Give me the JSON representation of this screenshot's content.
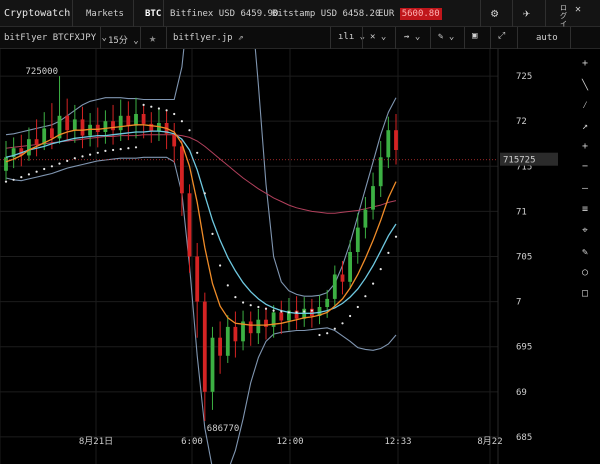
{
  "topbar": {
    "brand": "Cryptowatch",
    "markets": "Markets",
    "coin": "BTC",
    "ticker1_exchange": "Bitfinex",
    "ticker1_pair": "USD",
    "ticker1_price": "6459.90",
    "ticker2_exchange": "Bitstamp",
    "ticker2_pair": "USD",
    "ticker2_price": "6458.20",
    "ticker3_pair": "EUR",
    "ticker3_price": "5600.80",
    "login": "ログイン"
  },
  "toolbar": {
    "market": "bitFlyer BTCFXJPY",
    "interval": "15分",
    "url": "bitflyer.jp",
    "scale": "auto"
  },
  "colors": {
    "up": "#3cb043",
    "down": "#d42323",
    "ema_fast": "#f08c28",
    "ema_slow": "#6ec8e0",
    "sma_long": "#b2405c",
    "bollinger": "#7f95b0",
    "parabolic": "#e8e8e8",
    "last_price_bg": "#2b2b2b"
  },
  "chart_data": {
    "type": "candlestick",
    "y_ticks": [
      "725",
      "72",
      "715",
      "71",
      "705",
      "7",
      "695",
      "69",
      "685"
    ],
    "y_tick_values": [
      725,
      720,
      715,
      710,
      705,
      700,
      695,
      690,
      685
    ],
    "x_ticks": [
      "8月21日",
      "6:00",
      "12:00",
      "12:33",
      "8月22"
    ],
    "high_label": "725000",
    "low_label": "686770",
    "last_price": "715725",
    "last_value": 715.725,
    "ylim": [
      682,
      728
    ],
    "candles": [
      [
        714.5,
        716,
        713.5,
        717.8
      ],
      [
        716,
        717,
        714.8,
        718.2
      ],
      [
        717,
        716.2,
        715,
        718.5
      ],
      [
        716.2,
        718,
        715.6,
        719.3
      ],
      [
        718,
        717.4,
        716.1,
        720.2
      ],
      [
        717.4,
        719.2,
        716.8,
        721
      ],
      [
        719.2,
        718.1,
        716.9,
        722
      ],
      [
        718.1,
        720.6,
        717.5,
        725
      ],
      [
        720.6,
        719,
        717.8,
        722.5
      ],
      [
        719,
        720.2,
        717.6,
        721.8
      ],
      [
        720.2,
        718.4,
        717,
        721.6
      ],
      [
        718.4,
        719.6,
        717.2,
        720.9
      ],
      [
        719.6,
        718.8,
        717.1,
        721.5
      ],
      [
        718.8,
        720,
        717.5,
        721.2
      ],
      [
        720,
        719,
        717.4,
        721.8
      ],
      [
        719,
        720.6,
        717.8,
        722.4
      ],
      [
        720.6,
        719.5,
        717.9,
        722.2
      ],
      [
        719.5,
        720.8,
        718.1,
        722.6
      ],
      [
        720.8,
        719.7,
        718.1,
        721.9
      ],
      [
        719.7,
        718.9,
        717.6,
        721
      ],
      [
        718.9,
        719.8,
        717.8,
        721.4
      ],
      [
        719.8,
        718.6,
        716.9,
        721.3
      ],
      [
        718.6,
        717.2,
        715.4,
        719.8
      ],
      [
        717.2,
        712,
        709.5,
        718
      ],
      [
        712,
        705,
        703.2,
        713
      ],
      [
        705,
        700,
        696,
        706.5
      ],
      [
        700,
        690,
        686.77,
        701
      ],
      [
        690,
        696,
        688,
        697.2
      ],
      [
        696,
        694,
        692,
        697.8
      ],
      [
        694,
        697.2,
        693.2,
        698.5
      ],
      [
        697.2,
        695.6,
        693.8,
        698.9
      ],
      [
        695.6,
        697.8,
        694.6,
        699
      ],
      [
        697.8,
        696.5,
        695.1,
        698.9
      ],
      [
        696.5,
        698,
        695.3,
        699.2
      ],
      [
        698,
        697.2,
        695.8,
        699.4
      ],
      [
        697.2,
        698.8,
        696,
        699.6
      ],
      [
        698.8,
        697.9,
        696.4,
        700.1
      ],
      [
        697.9,
        699,
        696.8,
        700.4
      ],
      [
        699,
        698.1,
        696.9,
        700.6
      ],
      [
        698.1,
        699.2,
        697.2,
        700.5
      ],
      [
        699.2,
        698.4,
        697.1,
        700.3
      ],
      [
        698.4,
        699.4,
        697.5,
        700.7
      ],
      [
        699.4,
        700.3,
        698.2,
        701.3
      ],
      [
        700.3,
        703,
        699.5,
        704
      ],
      [
        703,
        702.2,
        700.8,
        704.5
      ],
      [
        702.2,
        705.5,
        701.4,
        706.8
      ],
      [
        705.5,
        708.2,
        704.2,
        709.8
      ],
      [
        708.2,
        710.2,
        707,
        711.6
      ],
      [
        710.2,
        712.8,
        709.1,
        714.3
      ],
      [
        712.8,
        716,
        711.6,
        717.8
      ],
      [
        716,
        719,
        714.8,
        720.5
      ],
      [
        719,
        716.8,
        715.2,
        720.8
      ]
    ],
    "ema_fast": [
      715.5,
      715.8,
      716.2,
      716.8,
      717.2,
      717.6,
      718,
      718.5,
      718.8,
      719,
      719,
      719.1,
      719.1,
      719.2,
      719.3,
      719.4,
      719.5,
      719.6,
      719.6,
      719.5,
      719.4,
      719.2,
      718.8,
      717.5,
      715,
      711,
      706,
      702,
      699.5,
      698.2,
      697.6,
      697.5,
      697.4,
      697.4,
      697.4,
      697.5,
      697.6,
      697.8,
      698,
      698.2,
      698.3,
      698.5,
      698.8,
      699.5,
      700.3,
      701.5,
      703,
      704.8,
      706.8,
      709,
      711.5,
      713.3
    ],
    "ema_slow": [
      716,
      716.2,
      716.5,
      716.8,
      717,
      717.2,
      717.5,
      717.7,
      717.9,
      718.1,
      718.2,
      718.3,
      718.4,
      718.4,
      718.5,
      718.6,
      718.7,
      718.8,
      718.8,
      718.9,
      718.9,
      718.8,
      718.6,
      718,
      716.8,
      714.6,
      711.8,
      709,
      706.8,
      704.9,
      703.4,
      702.1,
      701.1,
      700.3,
      699.7,
      699.3,
      699,
      698.8,
      698.7,
      698.7,
      698.7,
      698.8,
      699,
      699.3,
      699.8,
      700.5,
      701.4,
      702.6,
      704,
      705.6,
      707.3,
      708.6
    ],
    "sma_long": [
      717,
      717.1,
      717.2,
      717.3,
      717.4,
      717.5,
      717.6,
      717.7,
      717.8,
      717.9,
      718,
      718.1,
      718.2,
      718.3,
      718.3,
      718.4,
      718.4,
      718.4,
      718.5,
      718.5,
      718.5,
      718.5,
      718.5,
      718.4,
      718.2,
      717.8,
      717.2,
      716.5,
      715.8,
      715.1,
      714.4,
      713.7,
      713.1,
      712.5,
      712,
      711.5,
      711.1,
      710.7,
      710.4,
      710.2,
      710,
      709.9,
      709.8,
      709.8,
      709.9,
      710,
      710.1,
      710.3,
      710.5,
      710.7,
      711,
      711.2
    ],
    "bb_upper": [
      718.5,
      718.6,
      718.8,
      719,
      719.2,
      719.4,
      719.6,
      720,
      720.6,
      721.2,
      721.8,
      722.2,
      722.4,
      722.6,
      722.6,
      722.6,
      722.5,
      722.5,
      722.4,
      722.4,
      722.4,
      722.4,
      722.4,
      726,
      734,
      742,
      748,
      752,
      754,
      752,
      748,
      742,
      734,
      724,
      713,
      705,
      702.2,
      701.2,
      700.8,
      700.6,
      700.6,
      700.7,
      701,
      702,
      704,
      706.5,
      709.5,
      712.5,
      715.5,
      718.5,
      721,
      722.6
    ],
    "bb_lower": [
      713.7,
      713.5,
      713.4,
      713.6,
      713.8,
      714,
      714.2,
      714.5,
      714.8,
      715,
      715.2,
      715.4,
      715.6,
      715.7,
      715.8,
      715.9,
      715.9,
      715.9,
      716,
      716,
      716,
      716,
      715.5,
      712,
      704,
      694,
      686,
      681.5,
      680,
      681.2,
      683.5,
      687,
      691,
      693.8,
      695.6,
      696.4,
      696.6,
      696.7,
      696.8,
      696.8,
      696.9,
      697,
      697.1,
      696.8,
      696.2,
      695.6,
      694.9,
      694.7,
      694.6,
      694.8,
      695.3,
      696.3
    ],
    "psar": [
      713.3,
      713.5,
      713.8,
      714.1,
      714.4,
      714.7,
      715,
      715.3,
      715.6,
      715.9,
      716.1,
      716.3,
      716.5,
      716.7,
      716.8,
      716.9,
      717,
      717.1,
      721.8,
      721.6,
      721.4,
      721.2,
      720.8,
      720,
      719,
      716.5,
      712,
      707.5,
      704,
      701.8,
      700.5,
      699.9,
      699.6,
      699.4,
      699.2,
      699,
      698.9,
      698.8,
      698.8,
      698.9,
      699,
      696.3,
      696.5,
      697,
      697.6,
      698.4,
      699.4,
      700.6,
      702,
      703.6,
      705.4,
      707.2
    ]
  },
  "sidebar": {
    "tools": [
      "+",
      "╲",
      "⁄",
      "↗",
      "+",
      "−",
      "―",
      "≡",
      "⌖",
      "✎",
      "○",
      "□"
    ]
  }
}
